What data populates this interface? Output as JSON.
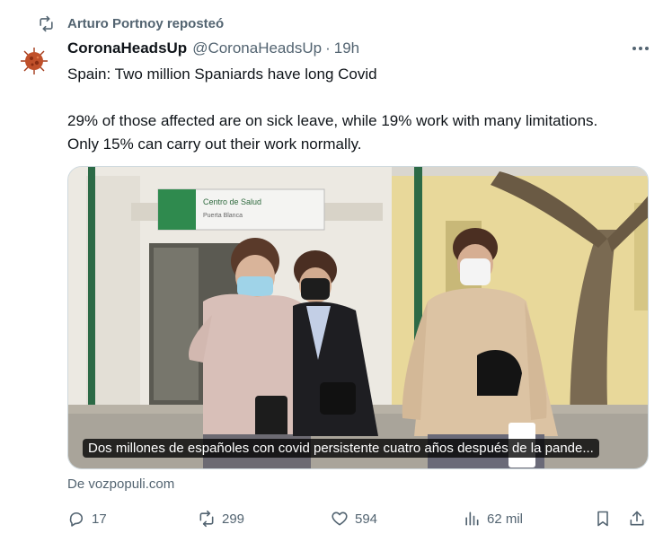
{
  "repost": {
    "text": "Arturo Portnoy reposteó",
    "icon": "repost-icon"
  },
  "author": {
    "display_name": "CoronaHeadsUp",
    "handle": "@CoronaHeadsUp",
    "separator": "·",
    "time": "19h"
  },
  "tweet": {
    "line1": "Spain: Two million Spaniards have long Covid",
    "line2": "29% of those affected are on sick leave, while 19% work with many limitations.",
    "line3": "Only 15% can carry out their work normally."
  },
  "media": {
    "caption": "Dos millones de españoles con covid persistente cuatro años después de la pande...",
    "sign_title": "Centro de Salud",
    "sign_subtitle": "Puerta Blanca"
  },
  "source": "De vozpopuli.com",
  "actions": {
    "replies": "17",
    "reposts": "299",
    "likes": "594",
    "views": "62 mil"
  },
  "colors": {
    "text": "#0f1419",
    "secondary": "#536471",
    "border": "#cfd9de"
  }
}
